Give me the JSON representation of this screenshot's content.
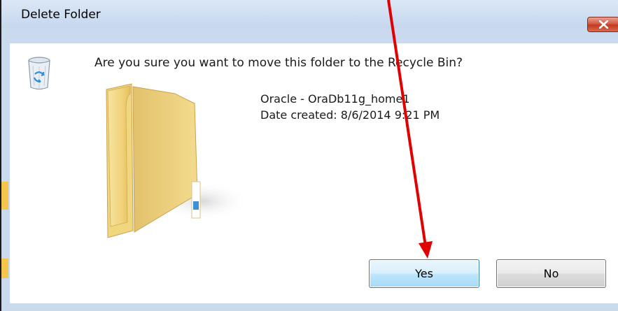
{
  "dialog": {
    "title": "Delete Folder",
    "close_icon": "close-x-icon",
    "question": "Are you sure you want to move this folder to the Recycle Bin?",
    "item": {
      "name": "Oracle - OraDb11g_home1",
      "date_created": "Date created: 8/6/2014 9:21 PM",
      "icon": "folder-icon"
    },
    "side_icon": "recycle-bin-icon",
    "buttons": {
      "yes_label": "Yes",
      "no_label": "No"
    }
  },
  "annotation": {
    "arrow_color": "#e00000",
    "target": "yes-button"
  },
  "colors": {
    "titlebar": "#c5d7ee",
    "close_button": "#c33a22",
    "yes_button_border": "#3c7fb1"
  }
}
